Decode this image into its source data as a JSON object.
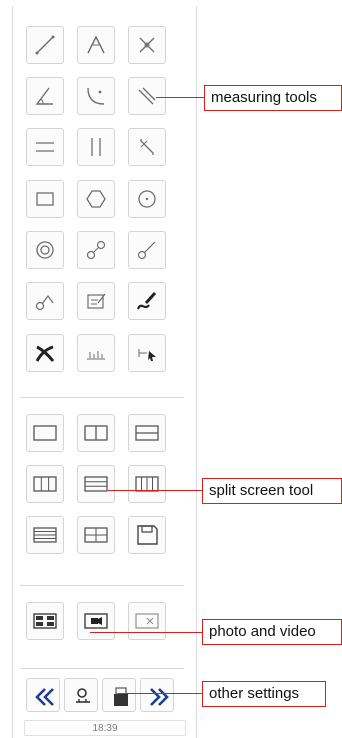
{
  "toolbar": {
    "measure_tools": [
      {
        "name": "line-tool"
      },
      {
        "name": "angle-arrow-tool"
      },
      {
        "name": "cross-distance-tool"
      },
      {
        "name": "angle-measure-tool"
      },
      {
        "name": "arc-tool"
      },
      {
        "name": "parallel-distance-tool"
      },
      {
        "name": "horizontal-parallel-tool"
      },
      {
        "name": "vertical-parallel-tool"
      },
      {
        "name": "zigzag-line-tool"
      },
      {
        "name": "rectangle-tool"
      },
      {
        "name": "hexagon-tool"
      },
      {
        "name": "circle-center-tool"
      },
      {
        "name": "concentric-circle-tool"
      },
      {
        "name": "two-circle-link-tool"
      },
      {
        "name": "circle-line-tool"
      },
      {
        "name": "circle-angle-tool"
      },
      {
        "name": "text-note-tool"
      },
      {
        "name": "freehand-draw-tool"
      },
      {
        "name": "delete-tool"
      },
      {
        "name": "count-tool"
      },
      {
        "name": "select-pointer-tool"
      }
    ],
    "split_tools": [
      {
        "name": "split-single"
      },
      {
        "name": "split-two-vertical"
      },
      {
        "name": "split-two-horizontal"
      },
      {
        "name": "split-three-vertical"
      },
      {
        "name": "split-three-horizontal"
      },
      {
        "name": "split-four-vertical"
      },
      {
        "name": "split-four-horizontal"
      },
      {
        "name": "split-quad"
      },
      {
        "name": "save-layout"
      }
    ],
    "media_tools": [
      {
        "name": "snapshot-grid"
      },
      {
        "name": "video-record"
      },
      {
        "name": "video-off"
      }
    ],
    "settings_tools": [
      {
        "name": "collapse-left"
      },
      {
        "name": "settings-gear"
      },
      {
        "name": "storage"
      },
      {
        "name": "expand-right"
      }
    ],
    "time": "18:39"
  },
  "callouts": {
    "measuring": "measuring tools",
    "split": "split screen tool",
    "photo": "photo and video",
    "settings": "other settings"
  },
  "colors": {
    "accent_red": "#d61f1f",
    "icon_gray": "#6e6e6e",
    "icon_dark": "#222222"
  }
}
